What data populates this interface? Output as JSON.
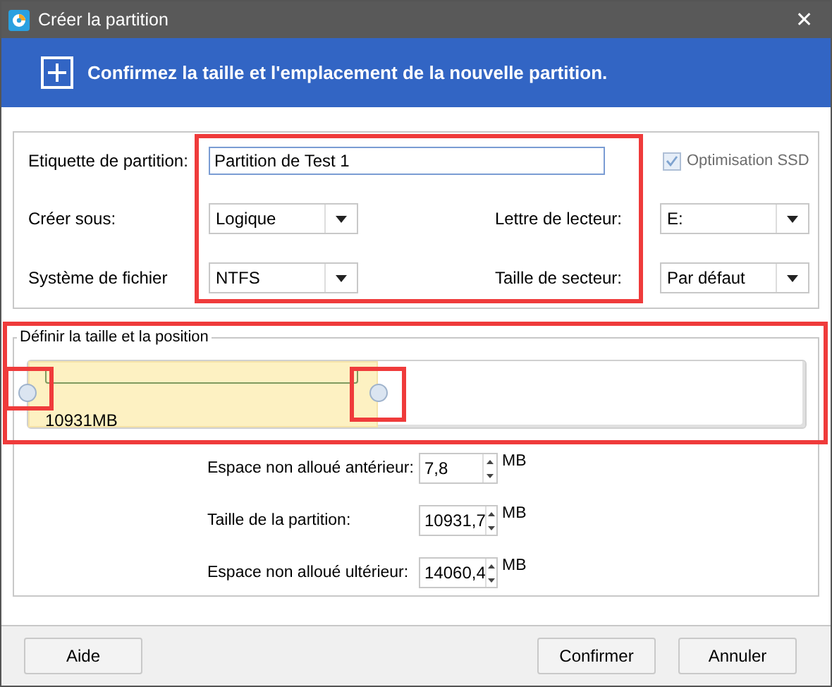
{
  "window": {
    "title": "Créer la partition",
    "close": "✕"
  },
  "banner": {
    "text": "Confirmez la taille et l'emplacement de la nouvelle partition."
  },
  "fields": {
    "highlighted": true,
    "label": {
      "label": "Etiquette de partition:",
      "value": "Partition de Test 1"
    },
    "ssd": {
      "label": "Optimisation SSD",
      "checked": true,
      "disabled": true
    },
    "create_as": {
      "label": "Créer sous:",
      "value": "Logique"
    },
    "drive_letter": {
      "label": "Lettre de lecteur:",
      "value": "E:"
    },
    "file_system": {
      "label": "Système de fichier",
      "value": "NTFS"
    },
    "sector_size": {
      "label": "Taille de secteur:",
      "value": "Par défaut"
    }
  },
  "size_section": {
    "title": "Définir la taille et la position",
    "highlighted": true,
    "handles_highlighted": true,
    "bar": {
      "level": 0.45,
      "size_label": "10931MB"
    },
    "spins": [
      {
        "label": "Espace non alloué antérieur:",
        "value": "7,8",
        "unit": "MB"
      },
      {
        "label": "Taille de la partition:",
        "value": "10931,7",
        "unit": "MB"
      },
      {
        "label": "Espace non alloué ultérieur:",
        "value": "14060,4",
        "unit": "MB"
      }
    ]
  },
  "buttons": [
    {
      "label": "Aide",
      "kind": "left"
    },
    {
      "label": "Confirmer",
      "kind": "right"
    },
    {
      "label": "Annuler",
      "kind": "right"
    }
  ]
}
